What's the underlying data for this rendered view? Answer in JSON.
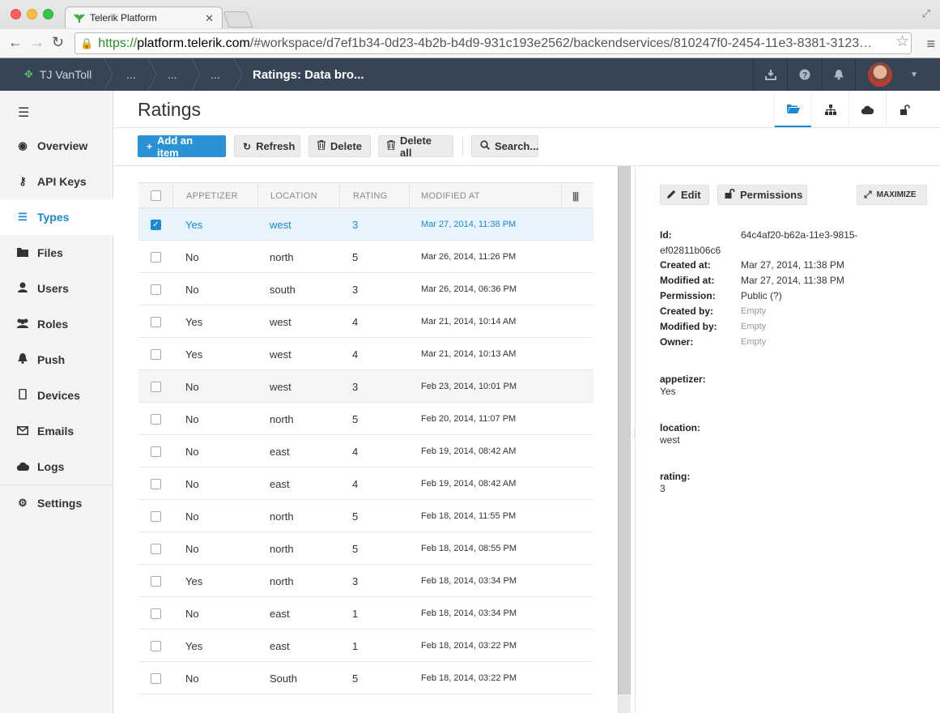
{
  "browser": {
    "tab_title": "Telerik Platform",
    "url_scheme": "https://",
    "url_host": "platform.telerik.com",
    "url_path": "/#workspace/d7ef1b34-0d23-4b2b-b4d9-931c193e2562/backendservices/810247f0-2454-11e3-8381-3123…"
  },
  "appbar": {
    "user": "TJ VanToll",
    "crumbs": [
      "...",
      "...",
      "..."
    ],
    "active_crumb": "Ratings: Data bro..."
  },
  "sidebar": {
    "items": [
      {
        "label": "Overview",
        "icon": "eye-icon"
      },
      {
        "label": "API Keys",
        "icon": "key-icon"
      },
      {
        "label": "Types",
        "icon": "list-icon"
      },
      {
        "label": "Files",
        "icon": "folder-icon"
      },
      {
        "label": "Users",
        "icon": "user-icon"
      },
      {
        "label": "Roles",
        "icon": "group-icon"
      },
      {
        "label": "Push",
        "icon": "bell-icon"
      },
      {
        "label": "Devices",
        "icon": "device-icon"
      },
      {
        "label": "Emails",
        "icon": "mail-icon"
      },
      {
        "label": "Logs",
        "icon": "cloud-icon"
      },
      {
        "label": "Settings",
        "icon": "gear-icon"
      }
    ]
  },
  "page": {
    "title": "Ratings"
  },
  "actions": {
    "add": "Add an item",
    "refresh": "Refresh",
    "delete": "Delete",
    "delete_all": "Delete all",
    "search": "Search..."
  },
  "grid": {
    "columns": [
      "APPETIZER",
      "LOCATION",
      "RATING",
      "MODIFIED AT"
    ],
    "rows": [
      {
        "appetizer": "Yes",
        "location": "west",
        "rating": "3",
        "modified": "Mar 27, 2014, 11:38 PM",
        "selected": true
      },
      {
        "appetizer": "No",
        "location": "north",
        "rating": "5",
        "modified": "Mar 26, 2014, 11:26 PM"
      },
      {
        "appetizer": "No",
        "location": "south",
        "rating": "3",
        "modified": "Mar 26, 2014, 06:36 PM"
      },
      {
        "appetizer": "Yes",
        "location": "west",
        "rating": "4",
        "modified": "Mar 21, 2014, 10:14 AM"
      },
      {
        "appetizer": "Yes",
        "location": "west",
        "rating": "4",
        "modified": "Mar 21, 2014, 10:13 AM"
      },
      {
        "appetizer": "No",
        "location": "west",
        "rating": "3",
        "modified": "Feb 23, 2014, 10:01 PM",
        "hover": true
      },
      {
        "appetizer": "No",
        "location": "north",
        "rating": "5",
        "modified": "Feb 20, 2014, 11:07 PM"
      },
      {
        "appetizer": "No",
        "location": "east",
        "rating": "4",
        "modified": "Feb 19, 2014, 08:42 AM"
      },
      {
        "appetizer": "No",
        "location": "east",
        "rating": "4",
        "modified": "Feb 19, 2014, 08:42 AM"
      },
      {
        "appetizer": "No",
        "location": "north",
        "rating": "5",
        "modified": "Feb 18, 2014, 11:55 PM"
      },
      {
        "appetizer": "No",
        "location": "north",
        "rating": "5",
        "modified": "Feb 18, 2014, 08:55 PM"
      },
      {
        "appetizer": "Yes",
        "location": "north",
        "rating": "3",
        "modified": "Feb 18, 2014, 03:34 PM"
      },
      {
        "appetizer": "No",
        "location": "east",
        "rating": "1",
        "modified": "Feb 18, 2014, 03:34 PM"
      },
      {
        "appetizer": "Yes",
        "location": "east",
        "rating": "1",
        "modified": "Feb 18, 2014, 03:22 PM"
      },
      {
        "appetizer": "No",
        "location": "South",
        "rating": "5",
        "modified": "Feb 18, 2014, 03:22 PM"
      }
    ]
  },
  "detail": {
    "edit": "Edit",
    "permissions": "Permissions",
    "maximize": "MAXIMIZE",
    "id_label": "Id:",
    "id_part1": "64c4af20-b62a-11e3-9815-",
    "id_part2": "ef02811b06c6",
    "meta": [
      {
        "label": "Created at:",
        "value": "Mar 27, 2014, 11:38 PM"
      },
      {
        "label": "Modified at:",
        "value": "Mar 27, 2014, 11:38 PM"
      },
      {
        "label": "Permission:",
        "value": "Public  (?)"
      },
      {
        "label": "Created by:",
        "value": "Empty",
        "empty": true
      },
      {
        "label": "Modified by:",
        "value": "Empty",
        "empty": true
      },
      {
        "label": "Owner:",
        "value": "Empty",
        "empty": true
      }
    ],
    "fields": [
      {
        "label": "appetizer:",
        "value": "Yes"
      },
      {
        "label": "location:",
        "value": "west"
      },
      {
        "label": "rating:",
        "value": "3"
      }
    ]
  },
  "colors": {
    "accent": "#1a8ad1",
    "appbar": "#354555",
    "primary_button": "#2a93d5"
  }
}
